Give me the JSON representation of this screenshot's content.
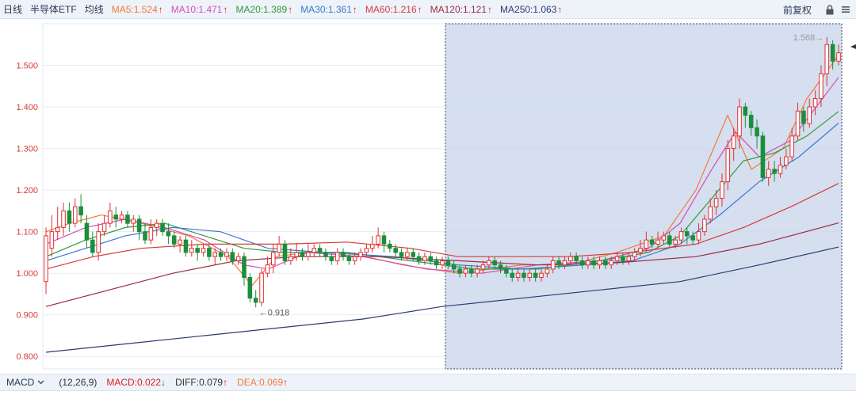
{
  "toolbar": {
    "period": "日线",
    "stock_name": "半导体ETF",
    "mode": "均线",
    "adjust": "前复权",
    "ma": [
      {
        "label": "MA5:1.524",
        "color": "#f07a3a",
        "trend": "up"
      },
      {
        "label": "MA10:1.471",
        "color": "#d94ab8",
        "trend": "up"
      },
      {
        "label": "MA20:1.389",
        "color": "#2f9a3a",
        "trend": "up"
      },
      {
        "label": "MA30:1.361",
        "color": "#3a78d0",
        "trend": "up"
      },
      {
        "label": "MA60:1.216",
        "color": "#d63b3b",
        "trend": "up"
      },
      {
        "label": "MA120:1.121",
        "color": "#9b2d45",
        "trend": "up"
      },
      {
        "label": "MA250:1.063",
        "color": "#2d3a72",
        "trend": "up"
      }
    ]
  },
  "icons": {
    "lock": "lock-icon",
    "menu": "menu-icon",
    "cursor": "cursor-marker-icon",
    "dropdown": "chevron-down-icon"
  },
  "colors": {
    "up_arrow": "#e02020",
    "down_arrow": "#1a8f3a",
    "candle_up": "#e03030",
    "candle_down": "#1a8f3a",
    "axis_label": "#d63b3b",
    "selection_fill": "#c9d6ea",
    "selection_border": "#33425f"
  },
  "chart_data": {
    "type": "candlestick",
    "y_ticks": [
      "1.500",
      "1.400",
      "1.300",
      "1.200",
      "1.100",
      "1.000",
      "0.900",
      "0.800"
    ],
    "ylim": [
      0.77,
      1.6
    ],
    "annotations": {
      "high_label": "1.568",
      "low_label": "0.918"
    },
    "candles": [
      [
        0.98,
        1.09,
        1.11,
        0.95
      ],
      [
        1.06,
        1.1,
        1.14,
        1.04
      ],
      [
        1.1,
        1.11,
        1.16,
        1.08
      ],
      [
        1.11,
        1.15,
        1.17,
        1.09
      ],
      [
        1.15,
        1.12,
        1.17,
        1.1
      ],
      [
        1.12,
        1.16,
        1.18,
        1.11
      ],
      [
        1.16,
        1.14,
        1.19,
        1.12
      ],
      [
        1.12,
        1.08,
        1.14,
        1.06
      ],
      [
        1.08,
        1.05,
        1.1,
        1.04
      ],
      [
        1.05,
        1.1,
        1.12,
        1.03
      ],
      [
        1.1,
        1.12,
        1.14,
        1.09
      ],
      [
        1.12,
        1.15,
        1.17,
        1.11
      ],
      [
        1.14,
        1.13,
        1.16,
        1.11
      ],
      [
        1.13,
        1.14,
        1.15,
        1.12
      ],
      [
        1.14,
        1.12,
        1.15,
        1.11
      ],
      [
        1.12,
        1.13,
        1.14,
        1.1
      ],
      [
        1.13,
        1.1,
        1.14,
        1.08
      ],
      [
        1.1,
        1.08,
        1.12,
        1.07
      ],
      [
        1.08,
        1.11,
        1.13,
        1.07
      ],
      [
        1.11,
        1.12,
        1.13,
        1.09
      ],
      [
        1.12,
        1.1,
        1.13,
        1.09
      ],
      [
        1.1,
        1.09,
        1.12,
        1.07
      ],
      [
        1.09,
        1.07,
        1.1,
        1.06
      ],
      [
        1.07,
        1.08,
        1.09,
        1.05
      ],
      [
        1.08,
        1.05,
        1.09,
        1.04
      ],
      [
        1.05,
        1.06,
        1.08,
        1.04
      ],
      [
        1.06,
        1.05,
        1.07,
        1.03
      ],
      [
        1.05,
        1.06,
        1.07,
        1.04
      ],
      [
        1.06,
        1.04,
        1.07,
        1.03
      ],
      [
        1.04,
        1.05,
        1.06,
        1.02
      ],
      [
        1.05,
        1.04,
        1.06,
        1.03
      ],
      [
        1.04,
        1.05,
        1.06,
        1.03
      ],
      [
        1.05,
        1.03,
        1.06,
        1.02
      ],
      [
        1.03,
        1.04,
        1.05,
        1.02
      ],
      [
        1.04,
        0.99,
        1.05,
        0.97
      ],
      [
        0.99,
        0.94,
        1.0,
        0.93
      ],
      [
        0.94,
        0.93,
        0.96,
        0.918
      ],
      [
        0.93,
        1.0,
        1.01,
        0.92
      ],
      [
        1.0,
        1.02,
        1.04,
        0.99
      ],
      [
        1.02,
        1.05,
        1.07,
        1.0
      ],
      [
        1.05,
        1.07,
        1.09,
        1.04
      ],
      [
        1.07,
        1.03,
        1.08,
        1.02
      ],
      [
        1.03,
        1.04,
        1.06,
        1.02
      ],
      [
        1.04,
        1.05,
        1.07,
        1.03
      ],
      [
        1.05,
        1.04,
        1.06,
        1.03
      ],
      [
        1.04,
        1.05,
        1.07,
        1.03
      ],
      [
        1.05,
        1.06,
        1.07,
        1.04
      ],
      [
        1.06,
        1.05,
        1.07,
        1.04
      ],
      [
        1.05,
        1.04,
        1.06,
        1.03
      ],
      [
        1.04,
        1.03,
        1.05,
        1.02
      ],
      [
        1.03,
        1.05,
        1.06,
        1.02
      ],
      [
        1.05,
        1.04,
        1.06,
        1.03
      ],
      [
        1.04,
        1.03,
        1.05,
        1.02
      ],
      [
        1.03,
        1.04,
        1.05,
        1.02
      ],
      [
        1.04,
        1.05,
        1.06,
        1.03
      ],
      [
        1.05,
        1.06,
        1.07,
        1.04
      ],
      [
        1.06,
        1.07,
        1.09,
        1.05
      ],
      [
        1.07,
        1.09,
        1.11,
        1.06
      ],
      [
        1.09,
        1.07,
        1.1,
        1.05
      ],
      [
        1.07,
        1.06,
        1.08,
        1.05
      ],
      [
        1.06,
        1.05,
        1.07,
        1.04
      ],
      [
        1.05,
        1.04,
        1.06,
        1.03
      ],
      [
        1.04,
        1.05,
        1.06,
        1.03
      ],
      [
        1.05,
        1.04,
        1.06,
        1.03
      ],
      [
        1.04,
        1.03,
        1.05,
        1.02
      ],
      [
        1.03,
        1.04,
        1.05,
        1.02
      ],
      [
        1.04,
        1.03,
        1.05,
        1.02
      ],
      [
        1.03,
        1.02,
        1.04,
        1.01
      ],
      [
        1.02,
        1.03,
        1.04,
        1.01
      ],
      [
        1.03,
        1.02,
        1.04,
        1.01
      ],
      [
        1.02,
        1.01,
        1.03,
        1.0
      ],
      [
        1.01,
        1.0,
        1.02,
        0.99
      ],
      [
        1.0,
        1.01,
        1.02,
        0.99
      ],
      [
        1.01,
        1.0,
        1.02,
        0.99
      ],
      [
        1.0,
        1.01,
        1.02,
        0.99
      ],
      [
        1.01,
        1.02,
        1.03,
        1.0
      ],
      [
        1.02,
        1.03,
        1.04,
        1.01
      ],
      [
        1.03,
        1.02,
        1.04,
        1.01
      ],
      [
        1.02,
        1.01,
        1.03,
        1.0
      ],
      [
        1.01,
        1.0,
        1.02,
        0.99
      ],
      [
        1.0,
        0.99,
        1.01,
        0.98
      ],
      [
        0.99,
        1.0,
        1.01,
        0.98
      ],
      [
        1.0,
        0.99,
        1.01,
        0.98
      ],
      [
        0.99,
        1.0,
        1.01,
        0.98
      ],
      [
        1.0,
        0.99,
        1.01,
        0.98
      ],
      [
        0.99,
        1.0,
        1.01,
        0.98
      ],
      [
        1.0,
        1.01,
        1.02,
        0.99
      ],
      [
        1.01,
        1.03,
        1.04,
        1.0
      ],
      [
        1.03,
        1.02,
        1.04,
        1.01
      ],
      [
        1.02,
        1.03,
        1.04,
        1.01
      ],
      [
        1.03,
        1.04,
        1.05,
        1.02
      ],
      [
        1.04,
        1.03,
        1.05,
        1.02
      ],
      [
        1.03,
        1.02,
        1.04,
        1.01
      ],
      [
        1.02,
        1.03,
        1.04,
        1.01
      ],
      [
        1.03,
        1.02,
        1.04,
        1.01
      ],
      [
        1.02,
        1.03,
        1.04,
        1.01
      ],
      [
        1.03,
        1.02,
        1.04,
        1.01
      ],
      [
        1.02,
        1.03,
        1.04,
        1.01
      ],
      [
        1.03,
        1.04,
        1.05,
        1.02
      ],
      [
        1.04,
        1.03,
        1.05,
        1.02
      ],
      [
        1.03,
        1.04,
        1.05,
        1.02
      ],
      [
        1.04,
        1.05,
        1.06,
        1.03
      ],
      [
        1.05,
        1.06,
        1.08,
        1.04
      ],
      [
        1.06,
        1.08,
        1.1,
        1.05
      ],
      [
        1.08,
        1.07,
        1.09,
        1.06
      ],
      [
        1.07,
        1.08,
        1.1,
        1.06
      ],
      [
        1.08,
        1.09,
        1.1,
        1.07
      ],
      [
        1.09,
        1.07,
        1.1,
        1.06
      ],
      [
        1.07,
        1.08,
        1.09,
        1.06
      ],
      [
        1.08,
        1.1,
        1.11,
        1.07
      ],
      [
        1.1,
        1.09,
        1.11,
        1.07
      ],
      [
        1.09,
        1.08,
        1.1,
        1.07
      ],
      [
        1.08,
        1.1,
        1.12,
        1.07
      ],
      [
        1.1,
        1.13,
        1.14,
        1.09
      ],
      [
        1.13,
        1.16,
        1.18,
        1.12
      ],
      [
        1.16,
        1.18,
        1.2,
        1.14
      ],
      [
        1.18,
        1.22,
        1.24,
        1.16
      ],
      [
        1.22,
        1.3,
        1.32,
        1.2
      ],
      [
        1.3,
        1.33,
        1.35,
        1.27
      ],
      [
        1.33,
        1.4,
        1.42,
        1.3
      ],
      [
        1.4,
        1.38,
        1.41,
        1.35
      ],
      [
        1.38,
        1.35,
        1.39,
        1.33
      ],
      [
        1.35,
        1.33,
        1.37,
        1.3
      ],
      [
        1.33,
        1.23,
        1.34,
        1.22
      ],
      [
        1.23,
        1.25,
        1.27,
        1.21
      ],
      [
        1.25,
        1.24,
        1.27,
        1.22
      ],
      [
        1.24,
        1.26,
        1.28,
        1.23
      ],
      [
        1.26,
        1.28,
        1.3,
        1.25
      ],
      [
        1.28,
        1.33,
        1.35,
        1.27
      ],
      [
        1.33,
        1.39,
        1.41,
        1.32
      ],
      [
        1.39,
        1.36,
        1.4,
        1.34
      ],
      [
        1.36,
        1.4,
        1.42,
        1.35
      ],
      [
        1.4,
        1.42,
        1.44,
        1.38
      ],
      [
        1.42,
        1.48,
        1.5,
        1.4
      ],
      [
        1.48,
        1.55,
        1.568,
        1.45
      ],
      [
        1.55,
        1.51,
        1.56,
        1.49
      ],
      [
        1.51,
        1.53,
        1.55,
        1.5
      ]
    ],
    "ma_lines": [
      {
        "name": "MA5",
        "color": "#f07a3a",
        "values": [
          [
            0,
            1.1
          ],
          [
            0.03,
            1.12
          ],
          [
            0.07,
            1.14
          ],
          [
            0.12,
            1.12
          ],
          [
            0.18,
            1.09
          ],
          [
            0.23,
            1.04
          ],
          [
            0.26,
            0.97
          ],
          [
            0.29,
            1.04
          ],
          [
            0.33,
            1.05
          ],
          [
            0.38,
            1.05
          ],
          [
            0.45,
            1.02
          ],
          [
            0.52,
            1.0
          ],
          [
            0.6,
            1.02
          ],
          [
            0.66,
            1.02
          ],
          [
            0.72,
            1.05
          ],
          [
            0.78,
            1.09
          ],
          [
            0.82,
            1.2
          ],
          [
            0.86,
            1.38
          ],
          [
            0.89,
            1.25
          ],
          [
            0.93,
            1.3
          ],
          [
            0.96,
            1.42
          ],
          [
            1.0,
            1.524
          ]
        ]
      },
      {
        "name": "MA10",
        "color": "#d94ab8",
        "values": [
          [
            0,
            1.07
          ],
          [
            0.05,
            1.11
          ],
          [
            0.1,
            1.13
          ],
          [
            0.15,
            1.11
          ],
          [
            0.2,
            1.08
          ],
          [
            0.25,
            1.02
          ],
          [
            0.28,
            1.01
          ],
          [
            0.33,
            1.05
          ],
          [
            0.4,
            1.04
          ],
          [
            0.48,
            1.01
          ],
          [
            0.55,
            1.0
          ],
          [
            0.62,
            1.02
          ],
          [
            0.7,
            1.03
          ],
          [
            0.76,
            1.06
          ],
          [
            0.8,
            1.12
          ],
          [
            0.84,
            1.25
          ],
          [
            0.87,
            1.34
          ],
          [
            0.9,
            1.28
          ],
          [
            0.94,
            1.32
          ],
          [
            1.0,
            1.471
          ]
        ]
      },
      {
        "name": "MA20",
        "color": "#2f9a3a",
        "values": [
          [
            0,
            1.04
          ],
          [
            0.05,
            1.08
          ],
          [
            0.1,
            1.11
          ],
          [
            0.15,
            1.12
          ],
          [
            0.2,
            1.09
          ],
          [
            0.25,
            1.06
          ],
          [
            0.3,
            1.05
          ],
          [
            0.38,
            1.05
          ],
          [
            0.46,
            1.03
          ],
          [
            0.54,
            1.01
          ],
          [
            0.62,
            1.01
          ],
          [
            0.7,
            1.03
          ],
          [
            0.76,
            1.05
          ],
          [
            0.8,
            1.09
          ],
          [
            0.84,
            1.18
          ],
          [
            0.88,
            1.27
          ],
          [
            0.92,
            1.29
          ],
          [
            0.96,
            1.33
          ],
          [
            1.0,
            1.389
          ]
        ]
      },
      {
        "name": "MA30",
        "color": "#3a78d0",
        "values": [
          [
            0,
            1.03
          ],
          [
            0.05,
            1.06
          ],
          [
            0.1,
            1.09
          ],
          [
            0.16,
            1.11
          ],
          [
            0.22,
            1.1
          ],
          [
            0.28,
            1.06
          ],
          [
            0.35,
            1.05
          ],
          [
            0.44,
            1.04
          ],
          [
            0.52,
            1.02
          ],
          [
            0.6,
            1.01
          ],
          [
            0.68,
            1.02
          ],
          [
            0.74,
            1.03
          ],
          [
            0.8,
            1.07
          ],
          [
            0.85,
            1.14
          ],
          [
            0.9,
            1.22
          ],
          [
            0.95,
            1.28
          ],
          [
            1.0,
            1.361
          ]
        ]
      },
      {
        "name": "MA60",
        "color": "#d63b3b",
        "values": [
          [
            0,
            1.01
          ],
          [
            0.06,
            1.04
          ],
          [
            0.12,
            1.06
          ],
          [
            0.2,
            1.07
          ],
          [
            0.3,
            1.07
          ],
          [
            0.38,
            1.075
          ],
          [
            0.46,
            1.06
          ],
          [
            0.52,
            1.04
          ],
          [
            0.58,
            1.04
          ],
          [
            0.66,
            1.04
          ],
          [
            0.74,
            1.05
          ],
          [
            0.82,
            1.07
          ],
          [
            0.88,
            1.11
          ],
          [
            0.94,
            1.16
          ],
          [
            1.0,
            1.216
          ]
        ]
      },
      {
        "name": "MA120",
        "color": "#9b2d45",
        "values": [
          [
            0,
            0.92
          ],
          [
            0.08,
            0.96
          ],
          [
            0.16,
            1.0
          ],
          [
            0.24,
            1.03
          ],
          [
            0.32,
            1.04
          ],
          [
            0.42,
            1.04
          ],
          [
            0.52,
            1.03
          ],
          [
            0.62,
            1.02
          ],
          [
            0.72,
            1.025
          ],
          [
            0.82,
            1.04
          ],
          [
            0.9,
            1.07
          ],
          [
            1.0,
            1.121
          ]
        ]
      },
      {
        "name": "MA250",
        "color": "#2d3a72",
        "values": [
          [
            0,
            0.81
          ],
          [
            0.1,
            0.83
          ],
          [
            0.2,
            0.85
          ],
          [
            0.3,
            0.87
          ],
          [
            0.4,
            0.89
          ],
          [
            0.5,
            0.92
          ],
          [
            0.6,
            0.94
          ],
          [
            0.7,
            0.96
          ],
          [
            0.8,
            0.98
          ],
          [
            0.9,
            1.02
          ],
          [
            1.0,
            1.063
          ]
        ]
      }
    ],
    "selection": {
      "start_fraction": 0.496,
      "end_fraction": 1.0
    }
  },
  "macd": {
    "indicator": "MACD",
    "params": "(12,26,9)",
    "items": [
      {
        "label": "MACD:0.022",
        "color": "#e02020",
        "trend": "down"
      },
      {
        "label": "DIFF:0.079",
        "color": "#333333",
        "trend": "up"
      },
      {
        "label": "DEA:0.069",
        "color": "#f07a3a",
        "trend": "up"
      }
    ]
  }
}
